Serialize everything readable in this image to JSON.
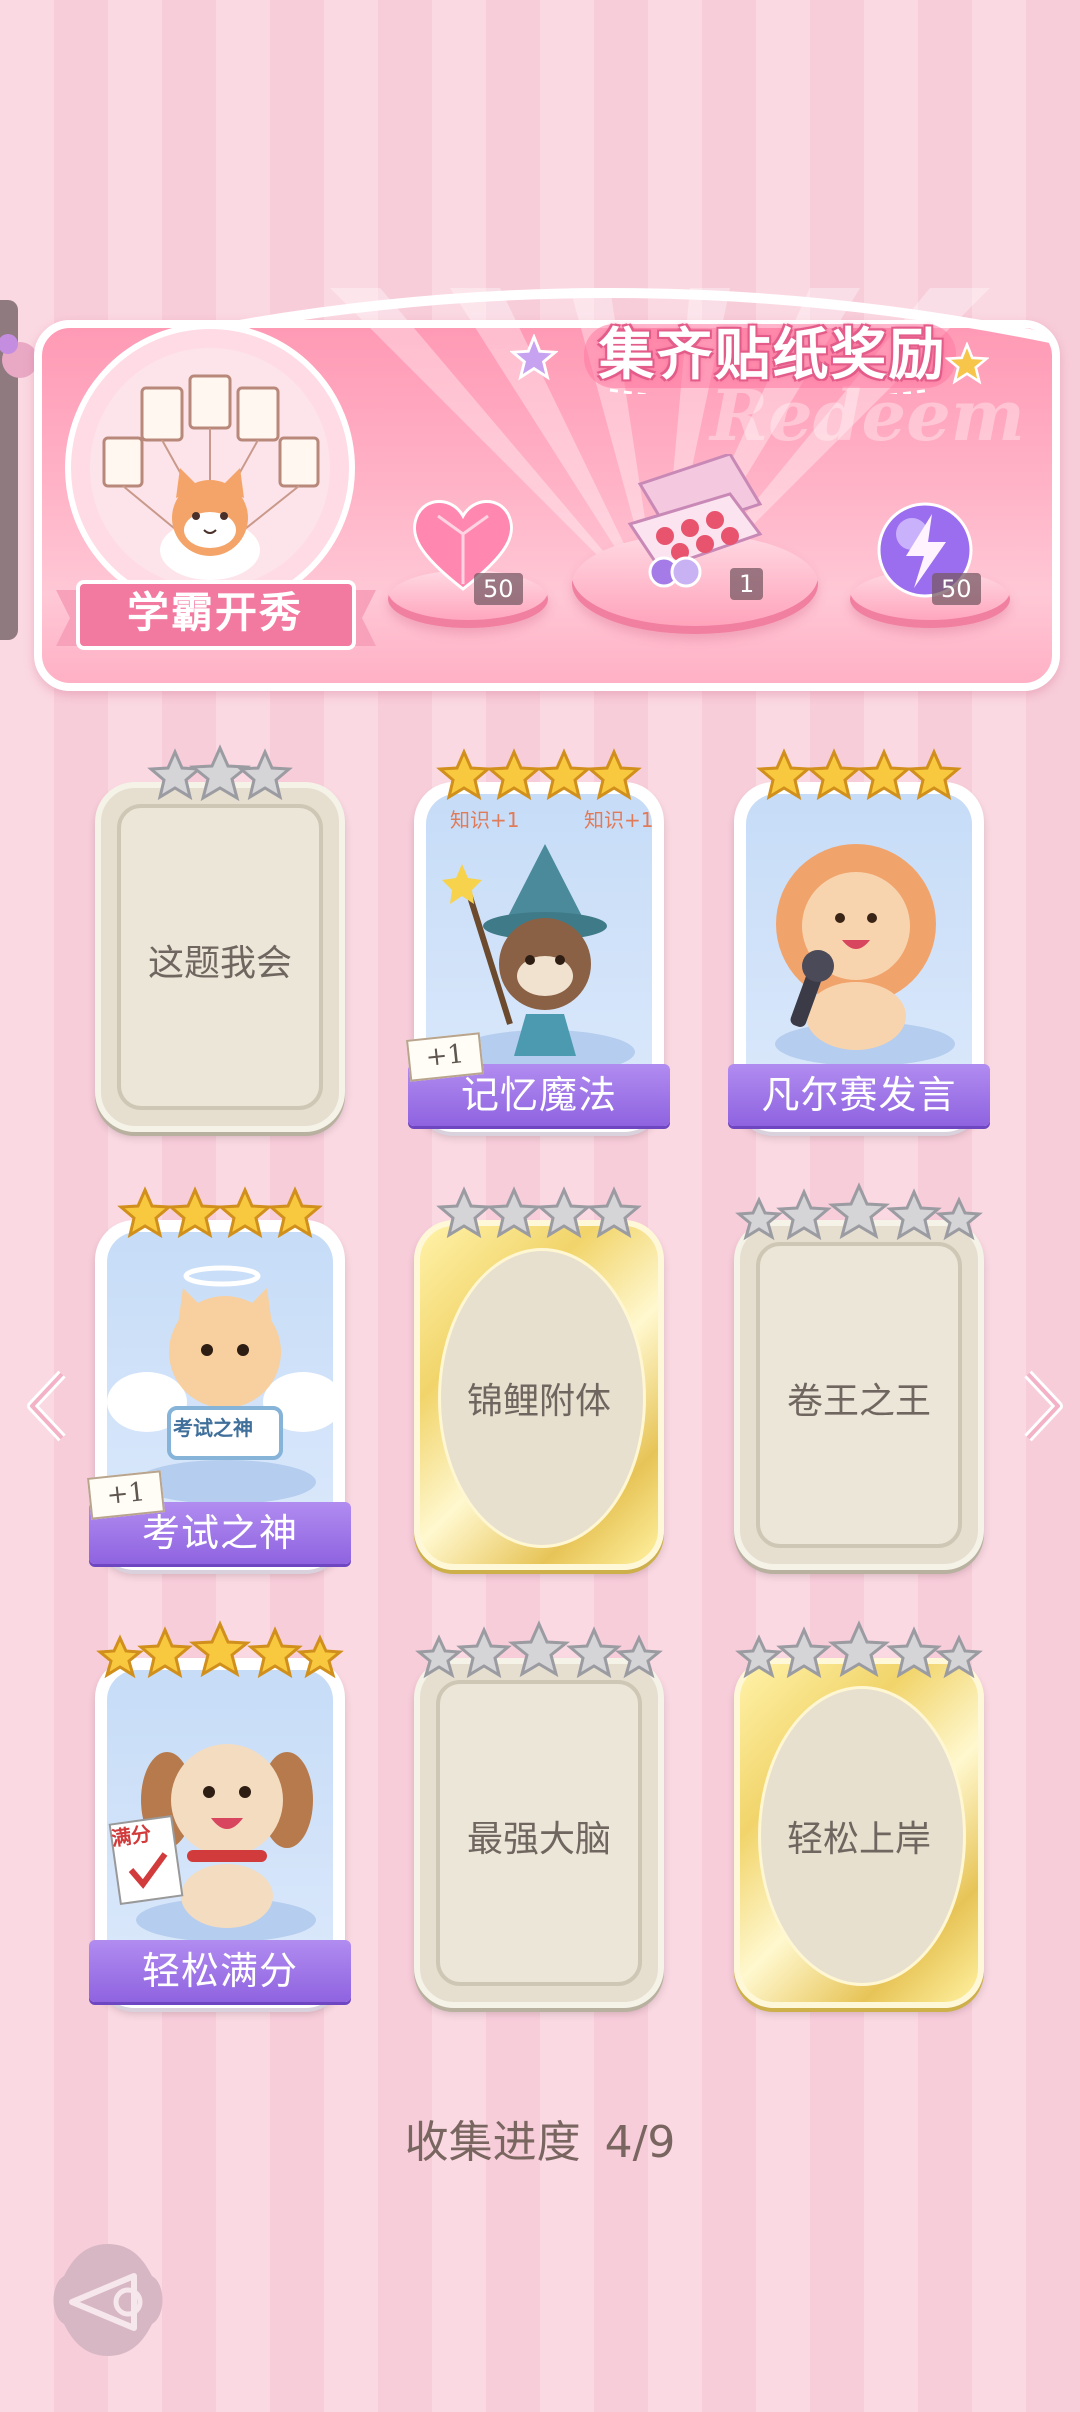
{
  "banner": {
    "title": "集齐贴纸奖励",
    "watermark": "Redeem",
    "crest_label": "学霸开秀",
    "rewards": [
      {
        "icon": "pink-heart-gem-icon",
        "count": "50"
      },
      {
        "icon": "gift-box-icon",
        "count": "1"
      },
      {
        "icon": "lightning-orb-icon",
        "count": "50"
      }
    ]
  },
  "cards": [
    {
      "name": "这题我会",
      "state": "locked-plain",
      "stars": 3,
      "star_color": "silver"
    },
    {
      "name": "记忆魔法",
      "state": "collected",
      "stars": 4,
      "star_color": "gold",
      "badge": "+1",
      "art": "otter-wizard",
      "art_texts": [
        "知识+1",
        "知识+1"
      ]
    },
    {
      "name": "凡尔赛发言",
      "state": "collected",
      "stars": 4,
      "star_color": "gold",
      "art": "lion-microphone"
    },
    {
      "name": "考试之神",
      "state": "collected",
      "stars": 4,
      "star_color": "gold",
      "badge": "+1",
      "art": "angel-cat",
      "art_texts": [
        "考试之神"
      ]
    },
    {
      "name": "锦鲤附体",
      "state": "locked-gold",
      "stars": 4,
      "star_color": "silver"
    },
    {
      "name": "卷王之王",
      "state": "locked-plain",
      "stars": 5,
      "star_color": "silver"
    },
    {
      "name": "轻松满分",
      "state": "collected",
      "stars": 5,
      "star_color": "gold",
      "art": "puppy-paper",
      "art_texts": [
        "满分"
      ]
    },
    {
      "name": "最强大脑",
      "state": "locked-plain",
      "stars": 5,
      "star_color": "silver"
    },
    {
      "name": "轻松上岸",
      "state": "locked-gold",
      "stars": 5,
      "star_color": "silver"
    }
  ],
  "progress": {
    "label": "收集进度",
    "value": "4/9"
  },
  "colors": {
    "accent_pink": "#ff9ab5",
    "ribbon_purple": "#9a6fe6",
    "gold": "#f1d46a"
  }
}
